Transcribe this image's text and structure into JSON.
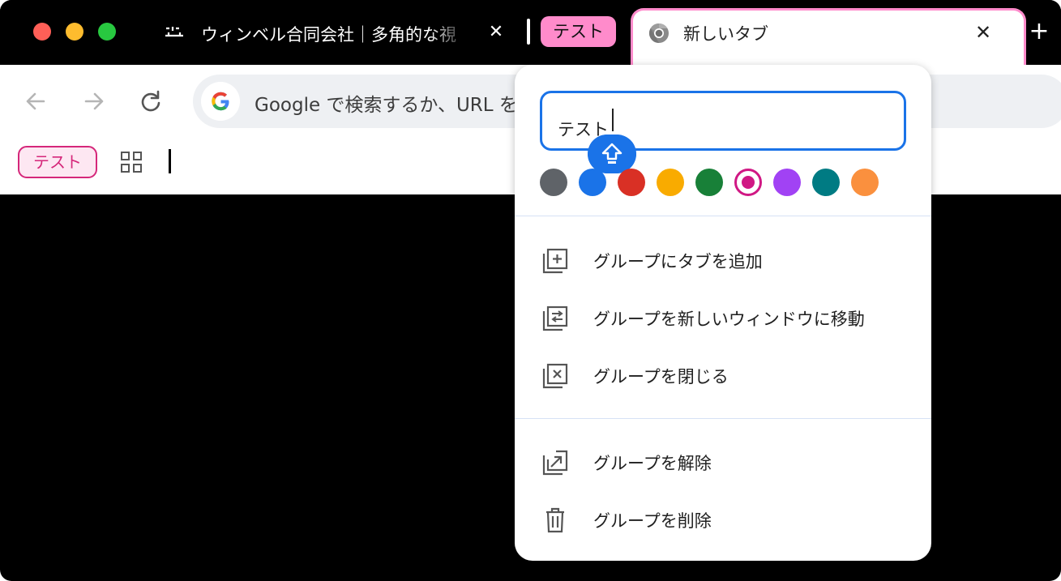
{
  "window": {
    "traffic_lights": [
      "close",
      "minimize",
      "maximize"
    ]
  },
  "tabs": {
    "first": {
      "title": "ウィンベル合同会社｜多角的な視",
      "close": "✕",
      "favicon": "winbell-logo-icon"
    },
    "group_chip": {
      "label": "テスト",
      "color": "#ff8bcb"
    },
    "active": {
      "title": "新しいタブ",
      "close": "✕",
      "favicon": "chrome-icon"
    },
    "new_tab": "+"
  },
  "toolbar": {
    "omnibox_placeholder": "Google で検索するか、URL を入力"
  },
  "bookmarks": {
    "group_chip": "テスト"
  },
  "group_editor": {
    "name_value": "テスト",
    "colors": [
      {
        "name": "grey",
        "hex": "#5f6368",
        "selected": false
      },
      {
        "name": "blue",
        "hex": "#1a73e8",
        "selected": false
      },
      {
        "name": "red",
        "hex": "#d93025",
        "selected": false
      },
      {
        "name": "yellow",
        "hex": "#f9ab00",
        "selected": false
      },
      {
        "name": "green",
        "hex": "#188038",
        "selected": false
      },
      {
        "name": "pink",
        "hex": "#d01884",
        "selected": true
      },
      {
        "name": "purple",
        "hex": "#a142f4",
        "selected": false
      },
      {
        "name": "cyan",
        "hex": "#007b83",
        "selected": false
      },
      {
        "name": "orange",
        "hex": "#fa903e",
        "selected": false
      }
    ],
    "menu": {
      "add_tab": "グループにタブを追加",
      "move_to_window": "グループを新しいウィンドウに移動",
      "close_group": "グループを閉じる",
      "ungroup": "グループを解除",
      "delete_group": "グループを削除"
    }
  }
}
